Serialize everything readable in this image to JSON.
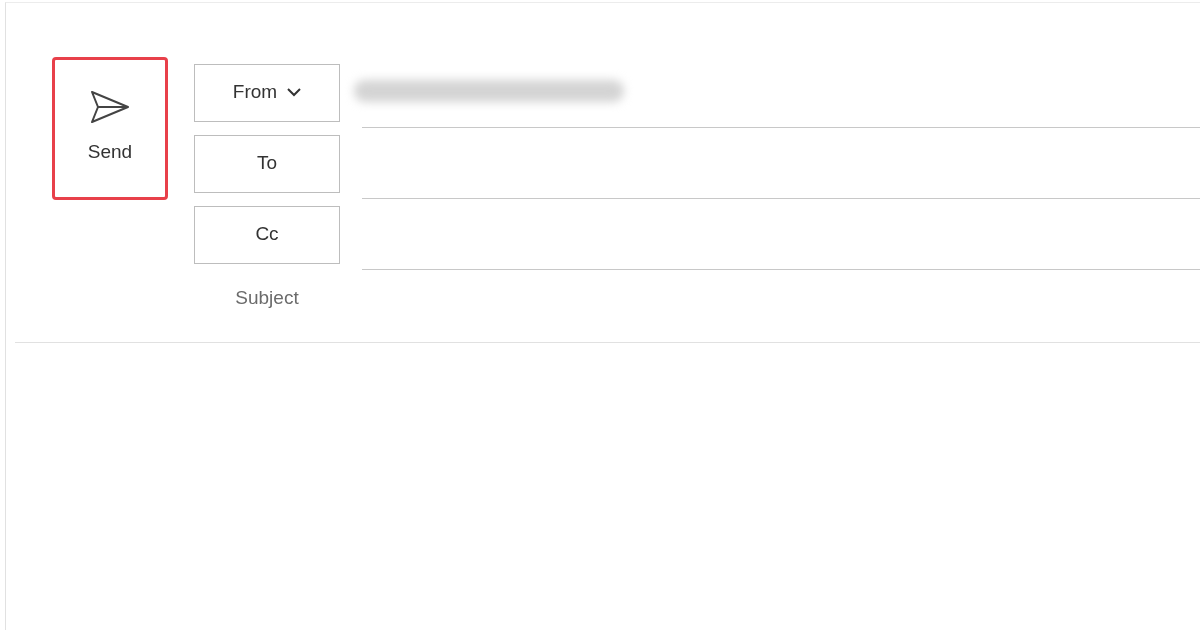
{
  "send_button": {
    "label": "Send",
    "highlighted": true
  },
  "fields": [
    {
      "kind": "from",
      "label": "From",
      "value_redacted": true
    },
    {
      "kind": "recipient",
      "label": "To"
    },
    {
      "kind": "recipient",
      "label": "Cc"
    }
  ],
  "subject": {
    "placeholder": "Subject"
  }
}
